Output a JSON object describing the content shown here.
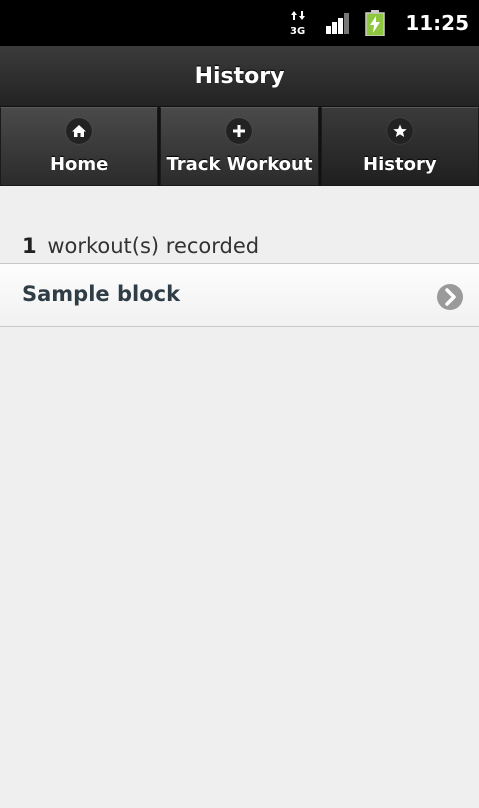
{
  "status_bar": {
    "time": "11:25",
    "network_icon": "3g-network-icon",
    "signal_icon": "signal-strength-icon",
    "battery_icon": "battery-charging-icon",
    "network_label": "3G"
  },
  "header": {
    "title": "History"
  },
  "navbar": {
    "tabs": [
      {
        "label": "Home",
        "icon": "home-icon"
      },
      {
        "label": "Track Workout",
        "icon": "plus-icon"
      },
      {
        "label": "History",
        "icon": "star-icon",
        "active": true
      }
    ]
  },
  "summary": {
    "count": "1",
    "text": "workout(s) recorded"
  },
  "workouts": [
    {
      "label": "Sample block",
      "icon": "chevron-right-icon"
    }
  ],
  "colors": {
    "status_bar_bg": "#000000",
    "header_bg": "#2d2d2d",
    "content_bg": "#efefef",
    "battery_green": "#8ec63f"
  }
}
